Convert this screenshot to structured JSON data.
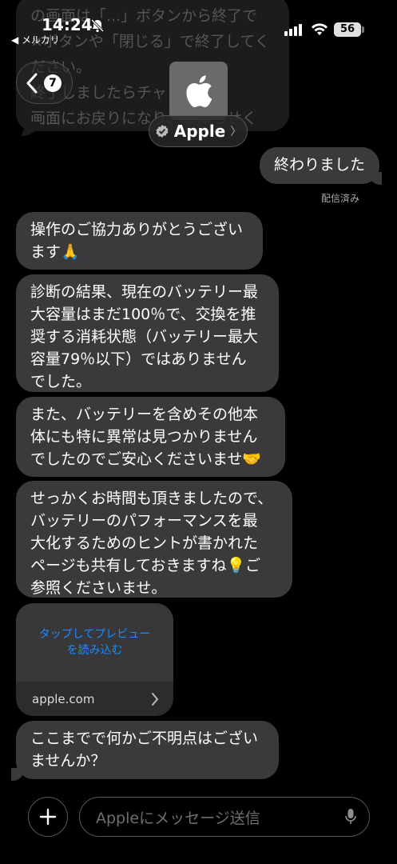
{
  "status_bar": {
    "time": "14:24",
    "back_app": "◀ メルカリ",
    "battery": "56"
  },
  "header": {
    "unread_count": "7",
    "contact_name": "Apple",
    "name_chevron": "〉"
  },
  "ghost_message": "の画面は「...」ボタンから終了で\n×ボタンや「閉じる」で終了してく\nださい。\n終了しましたらチャットの\n画面にお戻りになり、お知らせく\nださいませ。",
  "messages": {
    "outgoing": "終わりました",
    "delivered": "配信済み",
    "m1": "操作のご協力ありがとうござい\nます🙏",
    "m2": "診断の結果、現在のバッテリー最\n大容量はまだ100％で、交換を推\n奨する消耗状態（バッテリー最大\n容量79％以下）ではありません\nでした。",
    "m3": "また、バッテリーを含めその他本\n体にも特に異常は見つかりません\nでしたのでご安心くださいませ🤝",
    "m4": "せっかくお時間も頂きましたので、\nバッテリーのパフォーマンスを最\n大化するためのヒントが書かれた\nページも共有しておきますね💡ご\n参照くださいませ。",
    "link_preview": "タップしてプレビュー\nを読み込む",
    "link_domain": "apple.com",
    "link_chevron": "›",
    "m5": "ここまでで何かご不明点はござい\nませんか？"
  },
  "composer": {
    "placeholder": "Appleにメッセージ送信"
  },
  "colors": {
    "background": "#000000",
    "bubble": "#3a3a3c",
    "link": "#1a8cff"
  }
}
